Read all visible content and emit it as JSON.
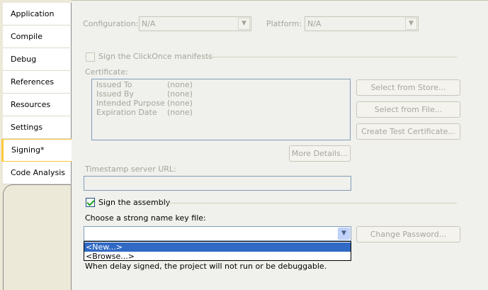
{
  "tabs": [
    {
      "label": "Application",
      "selected": false
    },
    {
      "label": "Compile",
      "selected": false
    },
    {
      "label": "Debug",
      "selected": false
    },
    {
      "label": "References",
      "selected": false
    },
    {
      "label": "Resources",
      "selected": false
    },
    {
      "label": "Settings",
      "selected": false
    },
    {
      "label": "Signing*",
      "selected": true
    },
    {
      "label": "Code Analysis",
      "selected": false
    }
  ],
  "configuration": {
    "label": "Configuration:",
    "value": "N/A",
    "enabled": false
  },
  "platform": {
    "label": "Platform:",
    "value": "N/A",
    "enabled": false
  },
  "clickonce": {
    "label": "Sign the ClickOnce manifests",
    "checked": false,
    "enabled": false
  },
  "certificate": {
    "label": "Certificate:",
    "rows": [
      {
        "key": "Issued To",
        "value": "(none)"
      },
      {
        "key": "Issued By",
        "value": "(none)"
      },
      {
        "key": "Intended Purpose",
        "value": "(none)"
      },
      {
        "key": "Expiration Date",
        "value": "(none)"
      }
    ],
    "select_from_store": "Select from Store...",
    "select_from_file": "Select from File...",
    "create_test_certificate": "Create Test Certificate...",
    "more_details": "More Details..."
  },
  "timestamp": {
    "label": "Timestamp server URL:",
    "value": ""
  },
  "sign_assembly": {
    "label": "Sign the assembly",
    "checked": true
  },
  "strong_name": {
    "label": "Choose a strong name key file:",
    "value": "",
    "options": [
      "<New...>",
      "<Browse...>"
    ],
    "highlighted": "<New...>",
    "change_password": "Change Password..."
  },
  "delay_sign_note": "When delay signed, the project will not run or be debuggable.",
  "colors": {
    "selected_tab_border": "#FFC83C",
    "highlight": "#316AC5",
    "checkmark": "#21A121"
  }
}
